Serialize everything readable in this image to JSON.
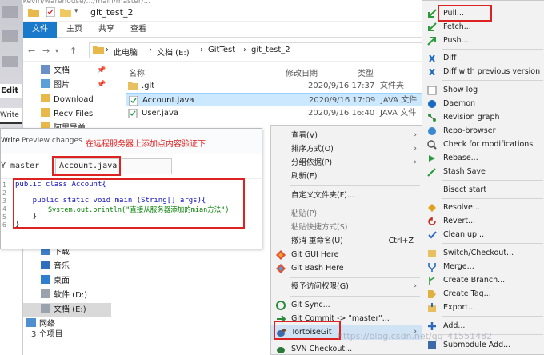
{
  "window": {
    "title": "git_test_2",
    "top_strip": "...kevin/warehouse/.../main/master/..."
  },
  "ribbon": {
    "tabs": [
      "文件",
      "主页",
      "共享",
      "查看"
    ]
  },
  "address": {
    "parts": [
      "此电脑",
      "文档 (E:)",
      "GitTest",
      "git_test_2"
    ]
  },
  "nav": {
    "items": [
      "文档",
      "图片",
      "Download",
      "Recv Files",
      "阿里导单",
      "下载",
      "音乐",
      "桌面",
      "软件 (D:)",
      "文档 (E:)",
      "网络"
    ]
  },
  "columns": {
    "name": "名称",
    "date": "修改日期",
    "type": "类型"
  },
  "files": [
    {
      "name": ".git",
      "date": "2020/9/16 17:37",
      "type": "文件夹"
    },
    {
      "name": "Account.java",
      "date": "2020/9/16 17:09",
      "type": "JAVA 文件"
    },
    {
      "name": "User.java",
      "date": "2020/9/16 16:40",
      "type": "JAVA 文件"
    }
  ],
  "status": "3 个项目",
  "behind": {
    "edit": "Edit fi",
    "write": "Write"
  },
  "editor": {
    "tab_write": "Write",
    "tab_preview": "Preview changes",
    "note": "在远程服务器上添加点内容验证下",
    "branch": "Y master",
    "filename": "Account.java",
    "line_numbers": [
      "1",
      "2",
      "3",
      "4",
      "5",
      "6"
    ],
    "code": [
      "public class Account{",
      "",
      "    public static void main (String[] args){",
      "        System.out.println(\"直接从服务器添加的mian方法\")",
      "    }",
      "}"
    ]
  },
  "context_menu": [
    {
      "label": "查看(V)",
      "arrow": true
    },
    {
      "label": "排序方式(O)",
      "arrow": true
    },
    {
      "label": "分组依据(P)",
      "arrow": true
    },
    {
      "label": "刷新(E)"
    },
    {
      "sep": true
    },
    {
      "label": "自定义文件夹(F)..."
    },
    {
      "sep": true
    },
    {
      "label": "粘贴(P)",
      "disabled": true
    },
    {
      "label": "粘贴快捷方式(S)",
      "disabled": true
    },
    {
      "label": "撤消 重命名(U)",
      "shortcut": "Ctrl+Z"
    },
    {
      "label": "Git GUI Here",
      "icon": "git-gui"
    },
    {
      "label": "Git Bash Here",
      "icon": "git-bash"
    },
    {
      "sep": true
    },
    {
      "label": "授予访问权限(G)",
      "arrow": true
    },
    {
      "sep": true
    },
    {
      "label": "Git Sync...",
      "icon": "sync"
    },
    {
      "label": "Git Commit -> \"master\"...",
      "icon": "commit"
    },
    {
      "label": "TortoiseGit",
      "icon": "tortoise",
      "arrow": true,
      "highlight": true
    },
    {
      "sep": true
    },
    {
      "label": "SVN Checkout...",
      "icon": "svn"
    }
  ],
  "tortoise_menu": [
    {
      "label": "Pull...",
      "icon": "pull"
    },
    {
      "label": "Fetch...",
      "icon": "fetch"
    },
    {
      "label": "Push...",
      "icon": "push"
    },
    {
      "sep": true
    },
    {
      "label": "Diff",
      "icon": "diff"
    },
    {
      "label": "Diff with previous version",
      "icon": "diff"
    },
    {
      "sep": true
    },
    {
      "label": "Show log",
      "icon": "log"
    },
    {
      "label": "Daemon",
      "icon": "daemon"
    },
    {
      "label": "Revision graph",
      "icon": "graph"
    },
    {
      "label": "Repo-browser",
      "icon": "browser"
    },
    {
      "label": "Check for modifications",
      "icon": "check"
    },
    {
      "label": "Rebase...",
      "icon": "rebase"
    },
    {
      "label": "Stash Save",
      "icon": "stash"
    },
    {
      "sep": true
    },
    {
      "label": "Bisect start",
      "icon": "none"
    },
    {
      "sep": true
    },
    {
      "label": "Resolve...",
      "icon": "resolve"
    },
    {
      "label": "Revert...",
      "icon": "revert"
    },
    {
      "label": "Clean up...",
      "icon": "clean"
    },
    {
      "sep": true
    },
    {
      "label": "Switch/Checkout...",
      "icon": "switch"
    },
    {
      "label": "Merge...",
      "icon": "merge"
    },
    {
      "label": "Create Branch...",
      "icon": "branch"
    },
    {
      "label": "Create Tag...",
      "icon": "tag"
    },
    {
      "label": "Export...",
      "icon": "export"
    },
    {
      "sep": true
    },
    {
      "label": "Add...",
      "icon": "add"
    },
    {
      "sep": true
    },
    {
      "label": "Submodule Add...",
      "icon": "submodule"
    }
  ],
  "watermark": "https://blog.csdn.net/qq_41551482",
  "colors": {
    "accent": "#1979ca",
    "highlight_border": "#dd2222",
    "selection": "#cce8ff"
  }
}
